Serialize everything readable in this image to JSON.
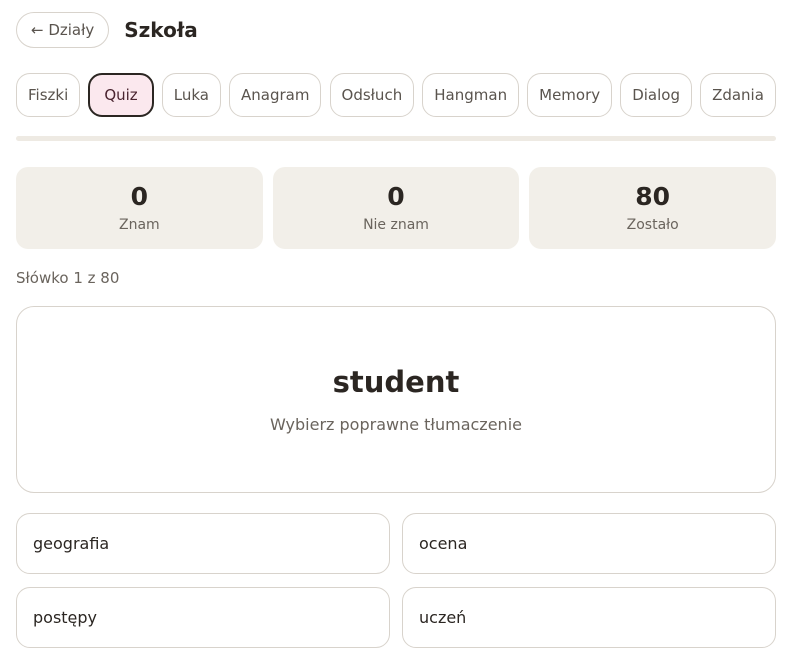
{
  "header": {
    "back_label": "← Działy",
    "title": "Szkoła"
  },
  "tabs": [
    {
      "label": "Fiszki",
      "active": false
    },
    {
      "label": "Quiz",
      "active": true
    },
    {
      "label": "Luka",
      "active": false
    },
    {
      "label": "Anagram",
      "active": false
    },
    {
      "label": "Odsłuch",
      "active": false
    },
    {
      "label": "Hangman",
      "active": false
    },
    {
      "label": "Memory",
      "active": false
    },
    {
      "label": "Dialog",
      "active": false
    },
    {
      "label": "Zdania",
      "active": false
    }
  ],
  "progress": {
    "percent": 0
  },
  "stats": [
    {
      "value": "0",
      "label": "Znam"
    },
    {
      "value": "0",
      "label": "Nie znam"
    },
    {
      "value": "80",
      "label": "Zostało"
    }
  ],
  "counter": "Słówko 1 z 80",
  "card": {
    "word": "student",
    "instruction": "Wybierz poprawne tłumaczenie"
  },
  "answers": [
    {
      "label": "geografia"
    },
    {
      "label": "ocena"
    },
    {
      "label": "postępy"
    },
    {
      "label": "uczeń"
    }
  ],
  "colors": {
    "accent": "#c97a8e",
    "active_tab_bg": "#fbe8ee",
    "stat_bg": "#f2efe9",
    "border": "#d8d3cc"
  }
}
